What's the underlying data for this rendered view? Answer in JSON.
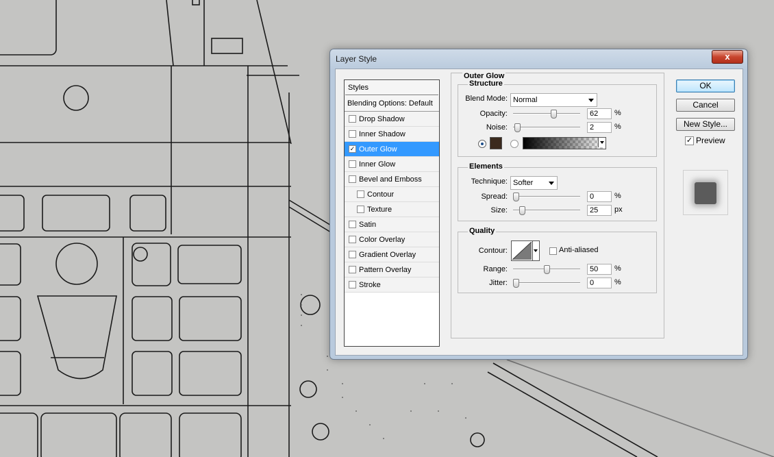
{
  "window": {
    "title": "Layer Style",
    "close_label": "x"
  },
  "styles_panel": {
    "header": "Styles",
    "blending_options": "Blending Options: Default",
    "items": [
      {
        "label": "Drop Shadow",
        "checked": false,
        "indent": false,
        "selected": false
      },
      {
        "label": "Inner Shadow",
        "checked": false,
        "indent": false,
        "selected": false
      },
      {
        "label": "Outer Glow",
        "checked": true,
        "indent": false,
        "selected": true
      },
      {
        "label": "Inner Glow",
        "checked": false,
        "indent": false,
        "selected": false
      },
      {
        "label": "Bevel and Emboss",
        "checked": false,
        "indent": false,
        "selected": false
      },
      {
        "label": "Contour",
        "checked": false,
        "indent": true,
        "selected": false
      },
      {
        "label": "Texture",
        "checked": false,
        "indent": true,
        "selected": false
      },
      {
        "label": "Satin",
        "checked": false,
        "indent": false,
        "selected": false
      },
      {
        "label": "Color Overlay",
        "checked": false,
        "indent": false,
        "selected": false
      },
      {
        "label": "Gradient Overlay",
        "checked": false,
        "indent": false,
        "selected": false
      },
      {
        "label": "Pattern Overlay",
        "checked": false,
        "indent": false,
        "selected": false
      },
      {
        "label": "Stroke",
        "checked": false,
        "indent": false,
        "selected": false
      }
    ]
  },
  "outer_glow": {
    "title": "Outer Glow",
    "structure": {
      "title": "Structure",
      "blend_mode_label": "Blend Mode:",
      "blend_mode_value": "Normal",
      "opacity_label": "Opacity:",
      "opacity_value": "62",
      "opacity_fraction": 0.62,
      "opacity_unit": "%",
      "noise_label": "Noise:",
      "noise_value": "2",
      "noise_fraction": 0.02,
      "noise_unit": "%",
      "glow_color": "#3b2a1e"
    },
    "elements": {
      "title": "Elements",
      "technique_label": "Technique:",
      "technique_value": "Softer",
      "spread_label": "Spread:",
      "spread_value": "0",
      "spread_fraction": 0.0,
      "spread_unit": "%",
      "size_label": "Size:",
      "size_value": "25",
      "size_fraction": 0.1,
      "size_unit": "px"
    },
    "quality": {
      "title": "Quality",
      "contour_label": "Contour:",
      "anti_aliased_label": "Anti-aliased",
      "anti_aliased": false,
      "range_label": "Range:",
      "range_value": "50",
      "range_fraction": 0.5,
      "range_unit": "%",
      "jitter_label": "Jitter:",
      "jitter_value": "0",
      "jitter_fraction": 0.0,
      "jitter_unit": "%"
    }
  },
  "buttons": {
    "ok": "OK",
    "cancel": "Cancel",
    "new_style": "New Style..."
  },
  "preview": {
    "label": "Preview",
    "checked": true
  }
}
